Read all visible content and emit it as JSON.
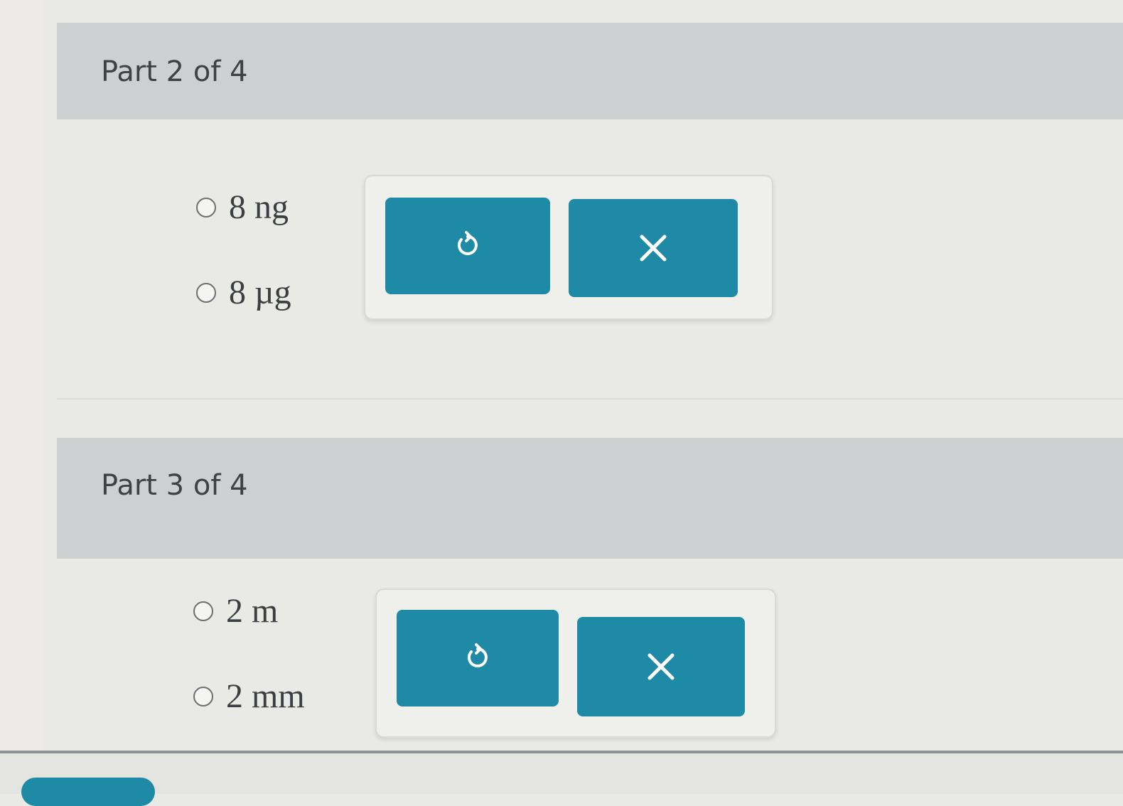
{
  "part2": {
    "title": "Part 2 of 4",
    "options": [
      {
        "label": "8 ng"
      },
      {
        "label": "8 µg"
      }
    ],
    "buttons": {
      "undo_icon": "undo-icon",
      "clear_icon": "close-icon"
    }
  },
  "part3": {
    "title": "Part 3 of 4",
    "options": [
      {
        "label": "2 m"
      },
      {
        "label": "2 mm"
      }
    ],
    "buttons": {
      "undo_icon": "undo-icon",
      "clear_icon": "close-icon"
    }
  },
  "colors": {
    "accent": "#1f8aa6",
    "header_bg": "#cdd0d0",
    "page_bg": "#e9e9e6"
  }
}
